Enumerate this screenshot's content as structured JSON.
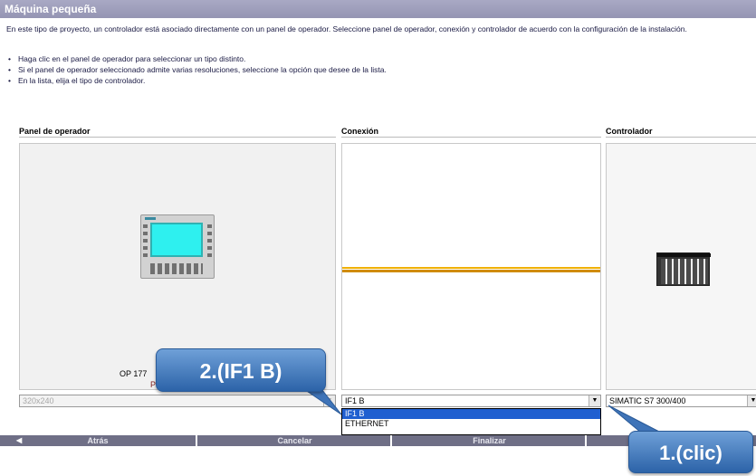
{
  "title": "Máquina pequeña",
  "intro": "En este tipo de proyecto, un controlador está asociado directamente con un panel de operador. Seleccione panel de operador, conexión y controlador de acuerdo con la configuración de la instalación.",
  "bullets": [
    "Haga clic en el panel de operador para seleccionar un tipo distinto.",
    "Si el panel de operador seleccionado admite varias resoluciones, seleccione la opción que desee de la lista.",
    "En la lista, elija el tipo de controlador."
  ],
  "columns": {
    "operator_panel": "Panel de operador",
    "connection": "Conexión",
    "controller": "Controlador"
  },
  "operator_panel": {
    "device_label": "OP 177",
    "device_label2": "Pl",
    "resolution_value": "320x240"
  },
  "connection": {
    "selected_value": "IF1 B",
    "options": [
      "IF1 B",
      "ETHERNET"
    ],
    "highlighted_option": "IF1 B"
  },
  "controller": {
    "selected_value": "SIMATIC S7 300/400"
  },
  "nav": {
    "back": "Atrás",
    "cancel": "Cancelar",
    "finish": "Finalizar"
  },
  "callouts": {
    "step2": "2.(IF1 B)",
    "step1": "1.(clic)"
  },
  "colors": {
    "title_bar": "#9d9db8",
    "nav_bar": "#6f6f86",
    "cable": "#f0b000",
    "hmi_screen": "#2ef0ef",
    "selection": "#1f5fd0",
    "callout": "#3d74bd"
  }
}
